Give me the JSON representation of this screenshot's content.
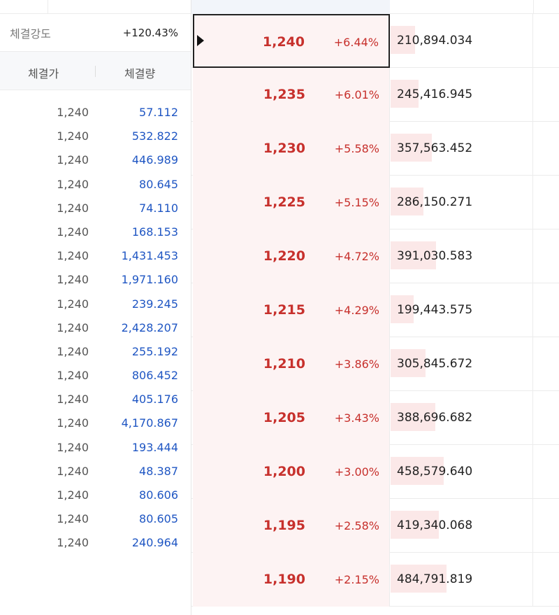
{
  "strength": {
    "label": "체결강도",
    "value": "+120.43%"
  },
  "trade_header": {
    "price": "체결가",
    "qty": "체결량"
  },
  "trades": [
    {
      "price": "1,240",
      "qty": "57.112"
    },
    {
      "price": "1,240",
      "qty": "532.822"
    },
    {
      "price": "1,240",
      "qty": "446.989"
    },
    {
      "price": "1,240",
      "qty": "80.645"
    },
    {
      "price": "1,240",
      "qty": "74.110"
    },
    {
      "price": "1,240",
      "qty": "168.153"
    },
    {
      "price": "1,240",
      "qty": "1,431.453"
    },
    {
      "price": "1,240",
      "qty": "1,971.160"
    },
    {
      "price": "1,240",
      "qty": "239.245"
    },
    {
      "price": "1,240",
      "qty": "2,428.207"
    },
    {
      "price": "1,240",
      "qty": "255.192"
    },
    {
      "price": "1,240",
      "qty": "806.452"
    },
    {
      "price": "1,240",
      "qty": "405.176"
    },
    {
      "price": "1,240",
      "qty": "4,170.867"
    },
    {
      "price": "1,240",
      "qty": "193.444"
    },
    {
      "price": "1,240",
      "qty": "48.387"
    },
    {
      "price": "1,240",
      "qty": "80.606"
    },
    {
      "price": "1,240",
      "qty": "80.605"
    },
    {
      "price": "1,240",
      "qty": "240.964"
    }
  ],
  "orderbook": [
    {
      "price": "1,240",
      "pct": "+6.44%",
      "volume": "210,894.034",
      "current": true
    },
    {
      "price": "1,235",
      "pct": "+6.01%",
      "volume": "245,416.945",
      "current": false
    },
    {
      "price": "1,230",
      "pct": "+5.58%",
      "volume": "357,563.452",
      "current": false
    },
    {
      "price": "1,225",
      "pct": "+5.15%",
      "volume": "286,150.271",
      "current": false
    },
    {
      "price": "1,220",
      "pct": "+4.72%",
      "volume": "391,030.583",
      "current": false
    },
    {
      "price": "1,215",
      "pct": "+4.29%",
      "volume": "199,443.575",
      "current": false
    },
    {
      "price": "1,210",
      "pct": "+3.86%",
      "volume": "305,845.672",
      "current": false
    },
    {
      "price": "1,205",
      "pct": "+3.43%",
      "volume": "388,696.682",
      "current": false
    },
    {
      "price": "1,200",
      "pct": "+3.00%",
      "volume": "458,579.640",
      "current": false
    },
    {
      "price": "1,195",
      "pct": "+2.58%",
      "volume": "419,340.068",
      "current": false
    },
    {
      "price": "1,190",
      "pct": "+2.15%",
      "volume": "484,791.819",
      "current": false
    }
  ],
  "colors": {
    "ask_red": "#c7302c",
    "qty_blue": "#1f56c3",
    "price_bg": "#fdf3f3",
    "volume_bar": "#fbe8e8"
  }
}
